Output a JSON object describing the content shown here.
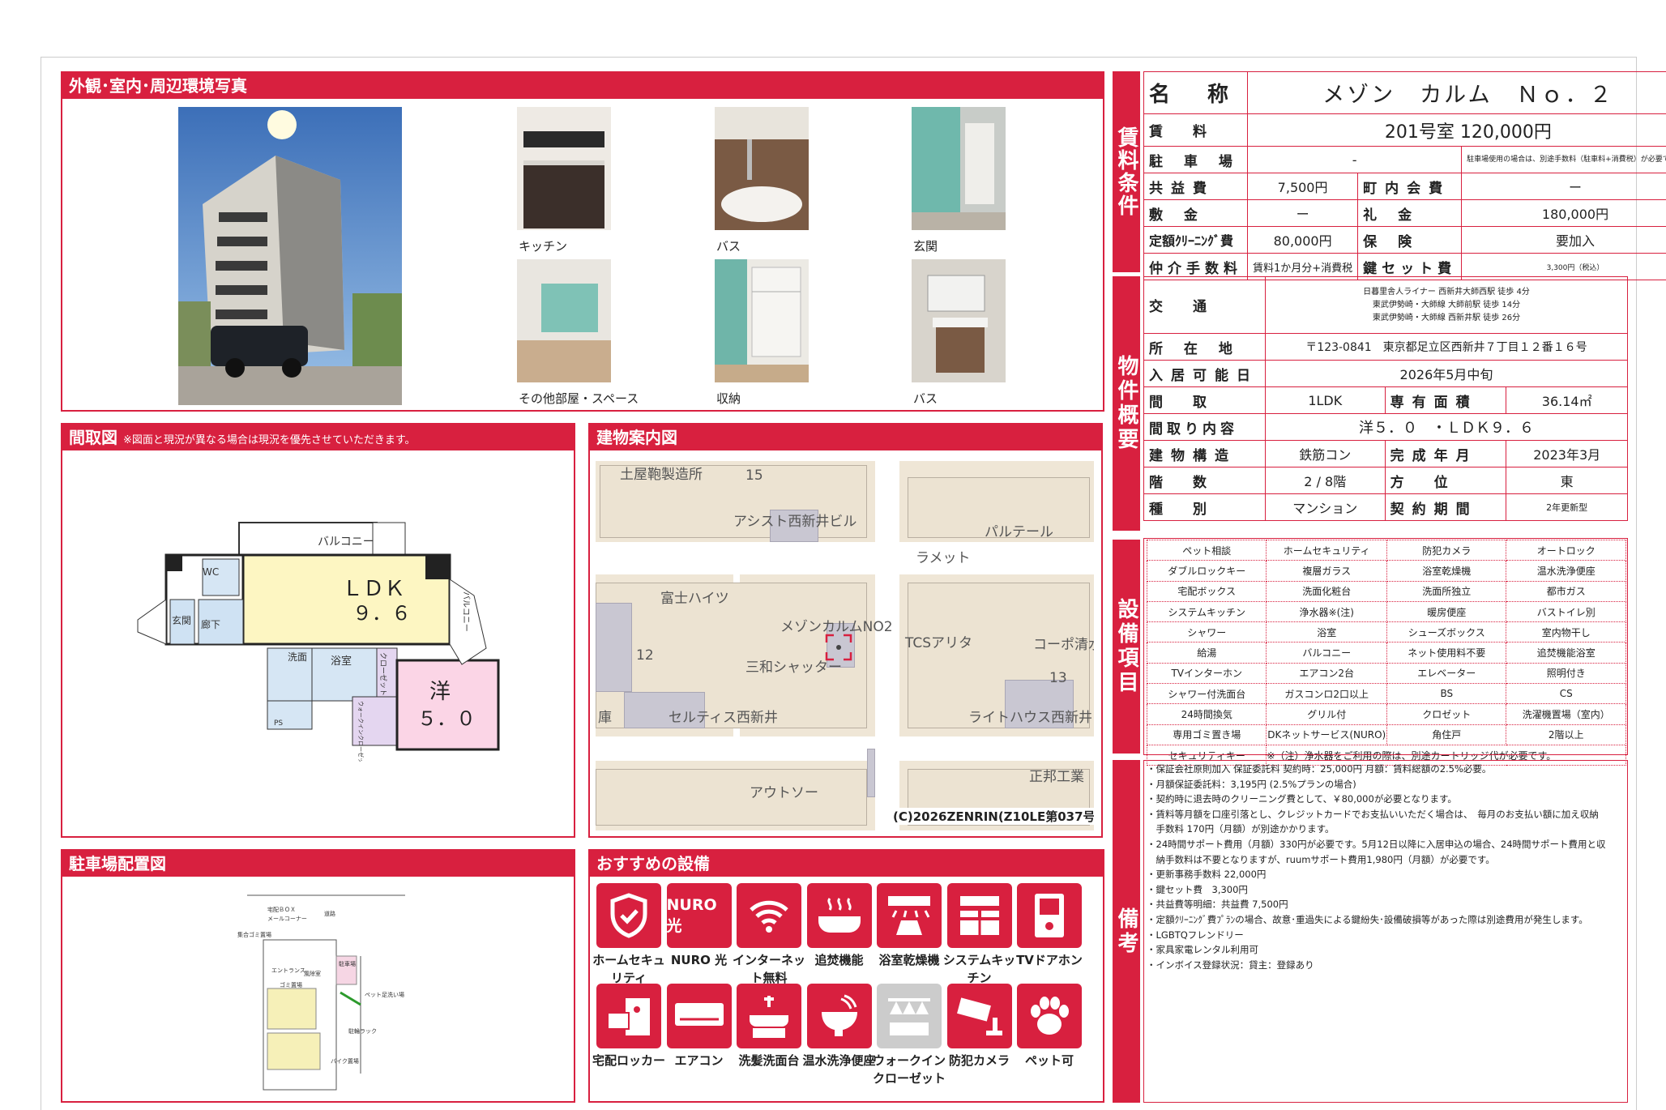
{
  "photos": {
    "title": "外観･室内･周辺環境写真",
    "captions": [
      "キッチン",
      "バス",
      "玄関",
      "その他部屋・スペース",
      "収納",
      "バス"
    ]
  },
  "floorplan": {
    "title": "間取図",
    "note": "※図面と現況が異なる場合は現況を優先させていただきます。",
    "labels": {
      "ldk": "ＬＤＫ",
      "ldk_size": "９．６",
      "yo": "洋",
      "yo_size": "５．０",
      "balcony_top": "バルコニー",
      "balcony_side": "バルコニー",
      "wc": "WC",
      "genkan": "玄関",
      "roka": "廊下",
      "senmen": "洗面",
      "yokushitsu": "浴室",
      "closet": "クローゼット",
      "walkin": "ウォークインクローゼット",
      "ps": "PS"
    }
  },
  "map": {
    "title": "建物案内図",
    "labels": [
      "土屋鞄製造所",
      "15",
      "アシスト西新井ビル",
      "パルテール",
      "ラメット",
      "富士ハイツ",
      "メゾンカルムNO2",
      "TCSアリタ",
      "コーポ清水",
      "12",
      "三和シャッター",
      "13",
      "庫",
      "セルティス西新井",
      "ライトハウス西新井",
      "正邦工業",
      "アウトソー"
    ],
    "copyright": "(C)2026ZENRIN(Z10LE第037号)"
  },
  "parking": {
    "title": "駐車場配置図",
    "labels": [
      "宅配ＢＯＸ",
      "メールコーナー",
      "道路",
      "集合ゴミ置場",
      "エントランス",
      "風除室",
      "駐車場",
      "ゴミ置場",
      "駐輪ラック",
      "ペット足洗い場",
      "バイク置場"
    ]
  },
  "recommend": {
    "title": "おすすめの設備",
    "items": [
      {
        "label": "ホームセキュリティ",
        "icon": "shield-icon",
        "color": "#d8203f"
      },
      {
        "label": "NURO 光",
        "icon": "nuro-icon",
        "text": "NURO光",
        "color": "#d8203f"
      },
      {
        "label": "インターネット無料",
        "icon": "wifi-icon",
        "color": "#d8203f"
      },
      {
        "label": "追焚機能",
        "icon": "bathtub-icon",
        "color": "#d8203f"
      },
      {
        "label": "浴室乾燥機",
        "icon": "dryer-icon",
        "color": "#d8203f"
      },
      {
        "label": "システムキッチン",
        "icon": "kitchen-icon",
        "color": "#d8203f"
      },
      {
        "label": "TVドアホン",
        "icon": "intercom-icon",
        "color": "#d8203f"
      },
      {
        "label": "宅配ロッカー",
        "icon": "locker-icon",
        "color": "#d8203f"
      },
      {
        "label": "エアコン",
        "icon": "aircon-icon",
        "color": "#d8203f"
      },
      {
        "label": "洗髪洗面台",
        "icon": "washbasin-icon",
        "color": "#d8203f"
      },
      {
        "label": "温水洗浄便座",
        "icon": "toilet-icon",
        "color": "#d8203f"
      },
      {
        "label": "ウォークインクローゼット",
        "icon": "closet-icon",
        "color": "#cccccc"
      },
      {
        "label": "防犯カメラ",
        "icon": "camera-icon",
        "color": "#d8203f"
      },
      {
        "label": "ペット可",
        "icon": "paw-icon",
        "color": "#d8203f"
      }
    ]
  },
  "rent": {
    "tab": "賃料条件",
    "name_label": "名　称",
    "name": "メゾン　カルム　Ｎｏ．２",
    "rent_label": "賃　料",
    "rent": "201号室 120,000円",
    "parking_label": "駐 車 場",
    "parking": "-",
    "parking_note": "駐車場使用の場合は、別途手数料（駐車料+消費税）が必要です。",
    "kyoeki_label": "共益費",
    "kyoeki": "7,500円",
    "chonai_label": "町内会費",
    "chonai": "ー",
    "shiki_label": "敷 金",
    "shiki": "ー",
    "rei_label": "礼 金",
    "rei": "180,000円",
    "cleaning_label": "定額ｸﾘｰﾆﾝｸﾞ費",
    "cleaning": "80,000円",
    "hoken_label": "保 険",
    "hoken": "要加入",
    "chukai_label": "仲介手数料",
    "chukai": "賃料1か月分+消費税",
    "key_label": "鍵セット費",
    "key": "3,300円（税込）"
  },
  "property": {
    "tab": "物件概要",
    "access_label": "交　通",
    "access": [
      "日暮里舎人ライナー 西新井大師西駅 徒歩 4分",
      "東武伊勢崎・大師線 大師前駅 徒歩 14分",
      "東武伊勢崎・大師線 西新井駅 徒歩 26分"
    ],
    "address_label": "所 在 地",
    "address": "〒123-0841　東京都足立区西新井７丁目１２番１６号",
    "movein_label": "入居可能日",
    "movein": "2026年5月中旬",
    "layout_label": "間　取",
    "layout": "1LDK",
    "area_label": "専有面積",
    "area": "36.14㎡",
    "detail_label": "間取り内容",
    "detail": "洋５．０　・ＬＤＫ９．６",
    "structure_label": "建物構造",
    "structure": "鉄筋コン",
    "built_label": "完成年月",
    "built": "2023年3月",
    "floor_label": "階　数",
    "floor": "2 / 8階",
    "dir_label": "方　位",
    "dir": "東",
    "type_label": "種　別",
    "type": "マンション",
    "contract_label": "契約期間",
    "contract": "2年更新型"
  },
  "equipment": {
    "tab": "設備項目",
    "rows": [
      [
        "ペット相談",
        "ホームセキュリティ",
        "防犯カメラ",
        "オートロック"
      ],
      [
        "ダブルロックキー",
        "複層ガラス",
        "浴室乾燥機",
        "温水洗浄便座"
      ],
      [
        "宅配ボックス",
        "洗面化粧台",
        "洗面所独立",
        "都市ガス"
      ],
      [
        "システムキッチン",
        "浄水器※(注)",
        "暖房便座",
        "バストイレ別"
      ],
      [
        "シャワー",
        "浴室",
        "シューズボックス",
        "室内物干し"
      ],
      [
        "給湯",
        "バルコニー",
        "ネット使用料不要",
        "追焚機能浴室"
      ],
      [
        "TVインターホン",
        "エアコン2台",
        "エレベーター",
        "照明付き"
      ],
      [
        "シャワー付洗面台",
        "ガスコンロ2口以上",
        "BS",
        "CS"
      ],
      [
        "24時間換気",
        "グリル付",
        "クロゼット",
        "洗濯機置場（室内）"
      ],
      [
        "専用ゴミ置き場",
        "DKネットサービス(NURO)",
        "角住戸",
        "2階以上"
      ]
    ],
    "last": [
      "セキュリティキー",
      "※（注）浄水器をご利用の際は、別途カートリッジ代が必要です。"
    ]
  },
  "remarks": {
    "tab": "備考",
    "lines": [
      "・保証会社原則加入 保証委託料 契約時：25,000円 月額：賃料総額の2.5%必要。",
      "・月額保証委託料：3,195円 (2.5%プランの場合)",
      "・契約時に退去時のクリーニング費として、￥80,000が必要となります。",
      "・賃料等月額を口座引落とし、クレジットカードでお支払いいただく場合は、　毎月のお支払い額に加え収納",
      "　手数料 170円（月額）が別途かかります。",
      "・24時間サポート費用（月額）330円が必要です。5月12日以降に入居申込の場合、24時間サポート費用と収",
      "　納手数料は不要となりますが、ruumサポート費用1,980円（月額）が必要です。",
      "・更新事務手数料 22,000円",
      "・鍵セット費　3,300円",
      "・共益費等明細：共益費 7,500円",
      "・定額ｸﾘｰﾆﾝｸﾞ費ﾌﾟﾗﾝの場合、故意･重過失による鍵紛失･設備破損等があった際は別途費用が発生します。",
      "・LGBTQフレンドリー",
      "・家具家電レンタル利用可",
      "・インボイス登録状況：貸主：登録あり"
    ]
  }
}
